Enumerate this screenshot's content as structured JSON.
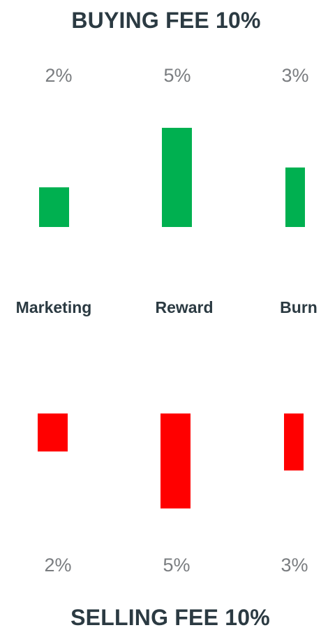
{
  "chart_data": [
    {
      "type": "bar",
      "title": "BUYING FEE 10%",
      "categories": [
        "Marketing",
        "Reward",
        "Burn"
      ],
      "values": [
        2,
        5,
        3
      ],
      "value_labels": [
        "2%",
        "5%",
        "3%"
      ],
      "color": "#00b050",
      "orientation": "upward"
    },
    {
      "type": "bar",
      "title": "SELLING FEE 10%",
      "categories": [
        "Marketing",
        "Reward",
        "Burn"
      ],
      "values": [
        2,
        5,
        3
      ],
      "value_labels": [
        "2%",
        "5%",
        "3%"
      ],
      "color": "#ff0000",
      "orientation": "downward"
    }
  ]
}
